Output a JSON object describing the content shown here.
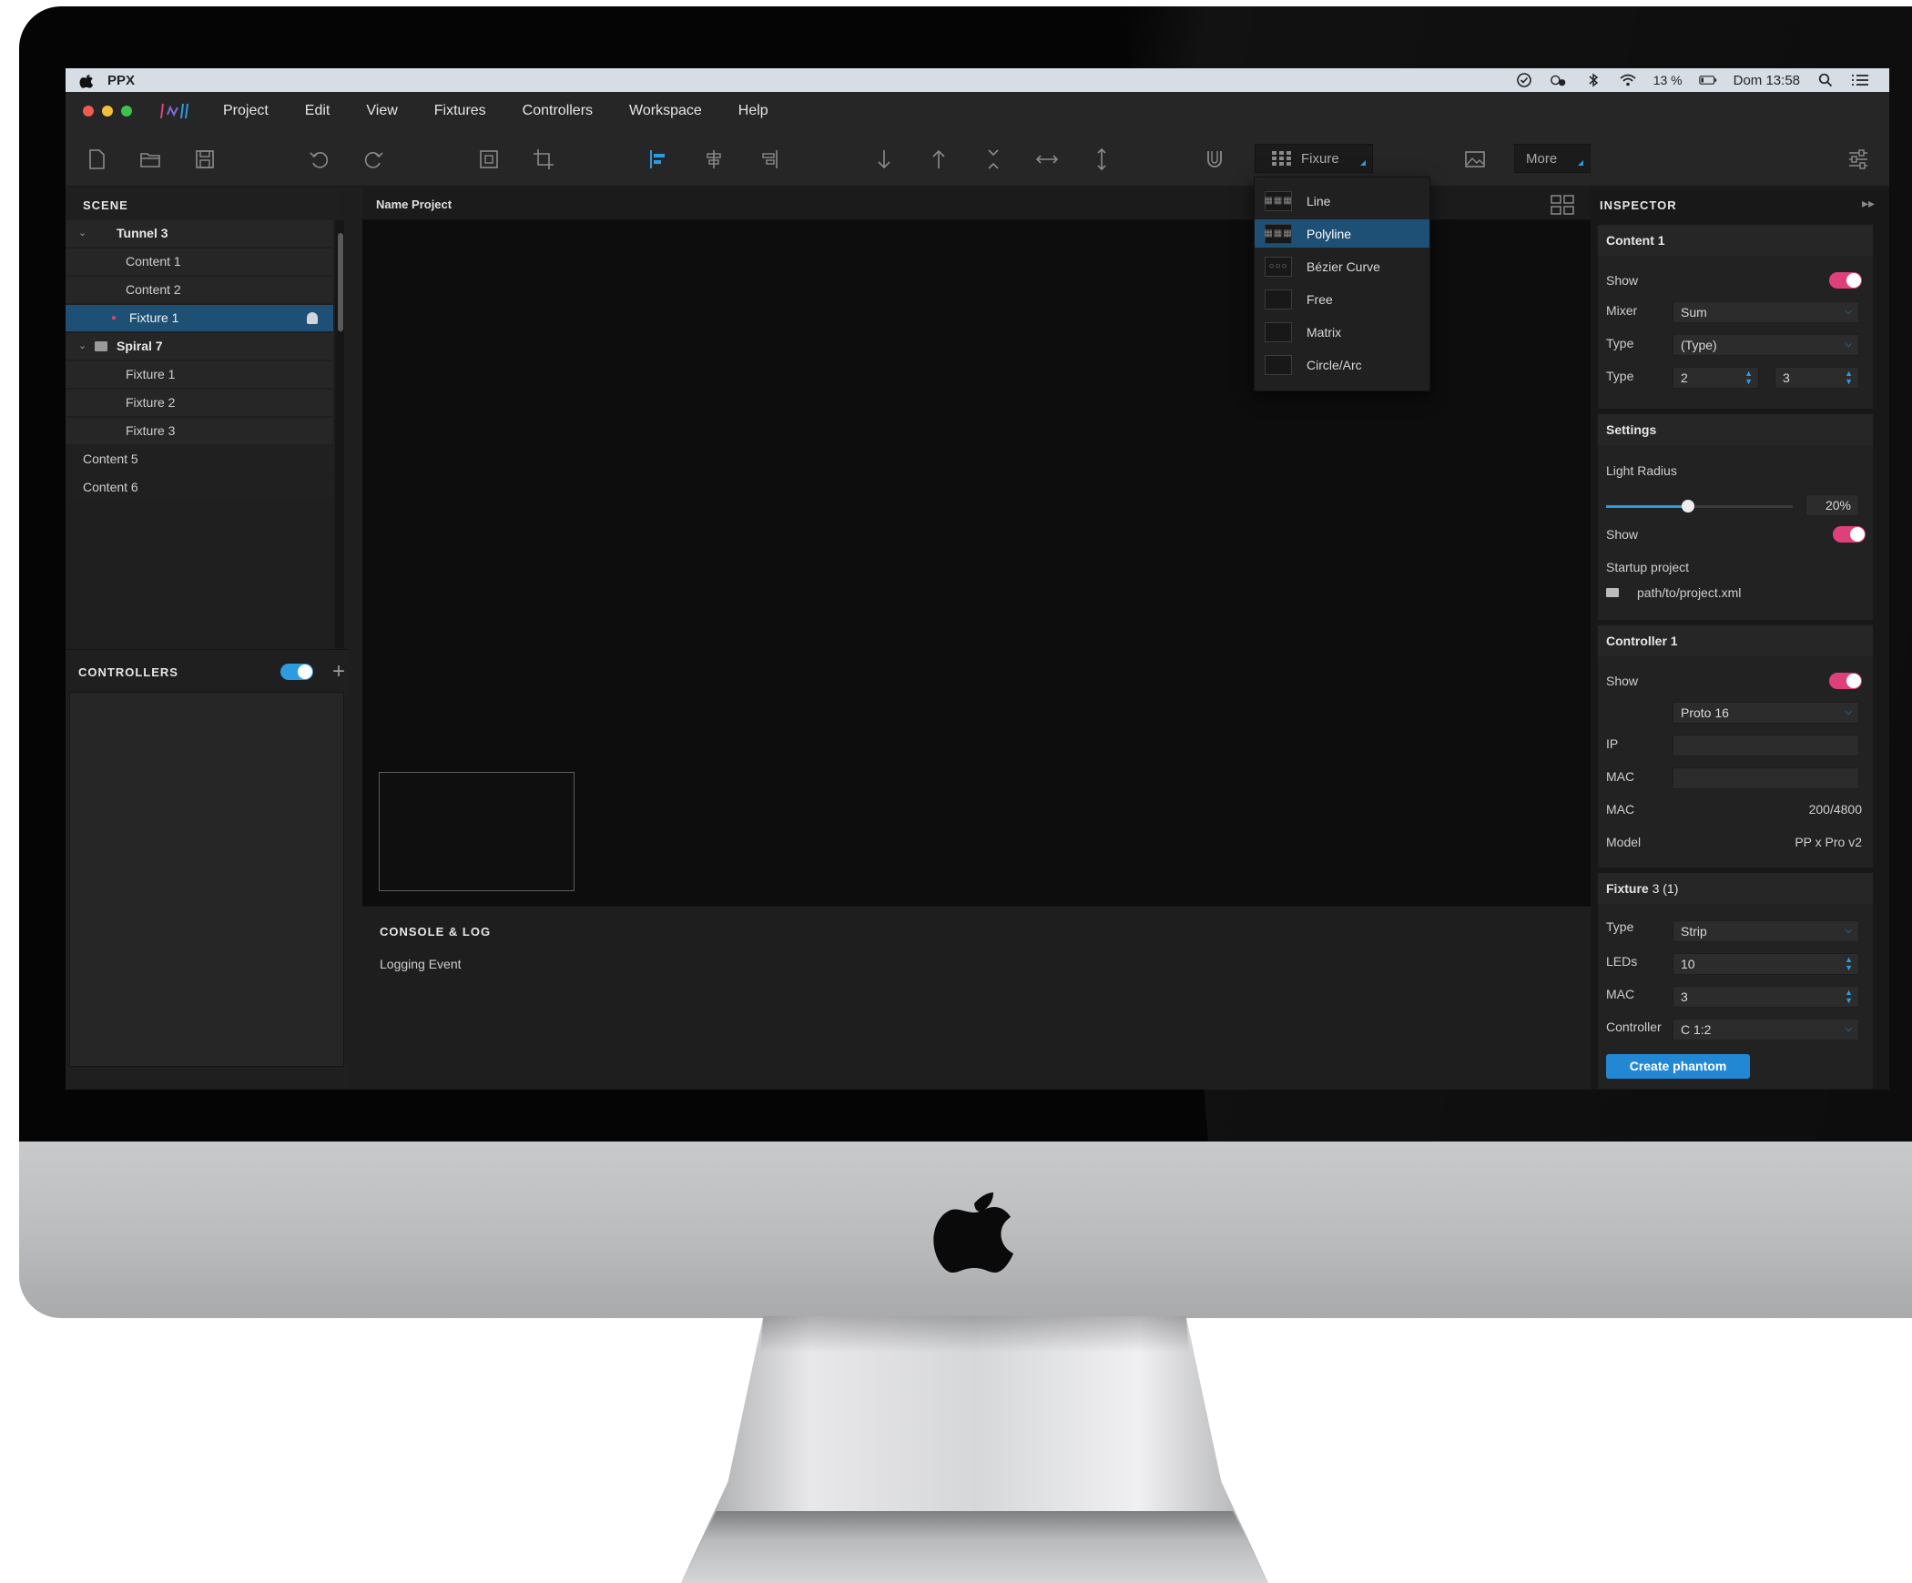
{
  "colors": {
    "accent": "#2d9be0",
    "selection": "#1e4f74",
    "toggle_on": "#e0407a",
    "toggle_on_blue": "#2d9be0",
    "button": "#2388d4"
  },
  "system_menubar": {
    "app_name": "PPX",
    "battery": "13 %",
    "clock": "Dom 13:58",
    "icons": [
      "apple-icon",
      "check-circle-icon",
      "sync-icon",
      "bluetooth-icon",
      "wifi-icon",
      "battery-icon",
      "search-icon",
      "list-icon"
    ]
  },
  "app_menu": {
    "items": [
      "Project",
      "Edit",
      "View",
      "Fixtures",
      "Controllers",
      "Workspace",
      "Help"
    ]
  },
  "toolbar": {
    "fixture_select": "Fixure",
    "more_label": "More",
    "icons": [
      "new-file-icon",
      "open-folder-icon",
      "save-icon",
      "undo-icon",
      "redo-icon",
      "frame-icon",
      "crop-icon",
      "align-left-icon",
      "align-center-icon",
      "align-right-icon",
      "arrow-down-icon",
      "arrow-up-icon",
      "collapse-vertical-icon",
      "horizontal-arrows-icon",
      "vertical-arrows-icon",
      "magnet-icon",
      "image-icon",
      "settings-sliders-icon"
    ]
  },
  "fixture_menu": {
    "items": [
      {
        "label": "Line",
        "icon": "grid-icon",
        "active": false
      },
      {
        "label": "Polyline",
        "icon": "grid-icon",
        "active": true
      },
      {
        "label": "Bézier Curve",
        "icon": "dots-icon",
        "active": false
      },
      {
        "label": "Free",
        "icon": "blank-icon",
        "active": false
      },
      {
        "label": "Matrix",
        "icon": "blank-icon",
        "active": false
      },
      {
        "label": "Circle/Arc",
        "icon": "blank-icon",
        "active": false
      }
    ]
  },
  "scene": {
    "title": "SCENE",
    "rows": [
      {
        "label": "Tunnel 3",
        "level": 0,
        "group": true
      },
      {
        "label": "Content 1",
        "level": 1
      },
      {
        "label": "Content 2",
        "level": 1
      },
      {
        "label": "Fixture 1",
        "level": 1,
        "selected": true
      },
      {
        "label": "Spiral 7",
        "level": 0,
        "group": true,
        "folder": true
      },
      {
        "label": "Fixture 1",
        "level": 1
      },
      {
        "label": "Fixture 2",
        "level": 1
      },
      {
        "label": "Fixture 3",
        "level": 1
      },
      {
        "label": "Content 5",
        "level": 0
      },
      {
        "label": "Content 6",
        "level": 0
      }
    ]
  },
  "controllers": {
    "title": "CONTROLLERS",
    "enabled": true
  },
  "canvas": {
    "project_name": "Name Project"
  },
  "console": {
    "title": "CONSOLE & LOG",
    "log": "Logging Event"
  },
  "inspector": {
    "title": "INSPECTOR",
    "content": {
      "header": "Content 1",
      "show_label": "Show",
      "show": true,
      "mixer_label": "Mixer",
      "mixer": "Sum",
      "type_label": "Type",
      "type": "(Type)",
      "type2_label": "Type",
      "type2_a": "2",
      "type2_b": "3"
    },
    "settings": {
      "header": "Settings",
      "light_radius_label": "Light Radius",
      "light_radius": "20%",
      "light_radius_value": 0.44,
      "show_label": "Show",
      "show": true,
      "startup_label": "Startup project",
      "startup_path": "path/to/project.xml"
    },
    "controller": {
      "header": "Controller 1",
      "show_label": "Show",
      "show": true,
      "model_select": "Proto 16",
      "ip_label": "IP",
      "ip": "",
      "mac_label": "MAC",
      "mac": "",
      "mac2_label": "MAC",
      "mac2": "200/4800",
      "model_label": "Model",
      "model": "PP x Pro v2"
    },
    "fixture": {
      "header": "Fixture",
      "header_suffix": "3 (1)",
      "type_label": "Type",
      "type": "Strip",
      "leds_label": "LEDs",
      "leds": "10",
      "mac_label": "MAC",
      "mac": "3",
      "controller_label": "Controller",
      "controller": "C 1:2",
      "create_label": "Create phantom"
    }
  }
}
